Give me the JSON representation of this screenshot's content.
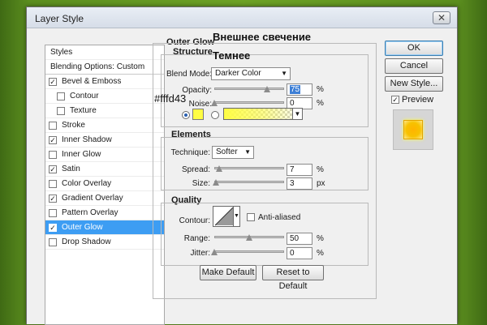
{
  "window": {
    "title": "Layer Style",
    "close_glyph": "✕"
  },
  "annotations": {
    "top": "Внешнее свечение",
    "sub": "Темнее",
    "hex": "#fffd43"
  },
  "sidebar": {
    "header": "Styles",
    "blending": "Blending Options: Custom",
    "items": [
      {
        "label": "Bevel & Emboss",
        "checked": true,
        "indent": false
      },
      {
        "label": "Contour",
        "checked": false,
        "indent": true
      },
      {
        "label": "Texture",
        "checked": false,
        "indent": true
      },
      {
        "label": "Stroke",
        "checked": false,
        "indent": false
      },
      {
        "label": "Inner Shadow",
        "checked": true,
        "indent": false
      },
      {
        "label": "Inner Glow",
        "checked": false,
        "indent": false
      },
      {
        "label": "Satin",
        "checked": true,
        "indent": false
      },
      {
        "label": "Color Overlay",
        "checked": false,
        "indent": false
      },
      {
        "label": "Gradient Overlay",
        "checked": true,
        "indent": false
      },
      {
        "label": "Pattern Overlay",
        "checked": false,
        "indent": false
      },
      {
        "label": "Outer Glow",
        "checked": true,
        "indent": false,
        "selected": true
      },
      {
        "label": "Drop Shadow",
        "checked": false,
        "indent": false
      }
    ]
  },
  "panel": {
    "title": "Outer Glow",
    "structure": {
      "label": "Structure",
      "blend_mode_label": "Blend Mode:",
      "blend_mode_value": "Darker Color",
      "opacity_label": "Opacity:",
      "opacity_value": "75",
      "noise_label": "Noise:",
      "noise_value": "0",
      "unit_percent": "%",
      "swatch_color": "#fffd43"
    },
    "elements": {
      "label": "Elements",
      "technique_label": "Technique:",
      "technique_value": "Softer",
      "spread_label": "Spread:",
      "spread_value": "7",
      "size_label": "Size:",
      "size_value": "3",
      "unit_px": "px"
    },
    "quality": {
      "label": "Quality",
      "contour_label": "Contour:",
      "anti_aliased_label": "Anti-aliased",
      "range_label": "Range:",
      "range_value": "50",
      "jitter_label": "Jitter:",
      "jitter_value": "0"
    },
    "make_default": "Make Default",
    "reset_default": "Reset to Default"
  },
  "buttons": {
    "ok": "OK",
    "cancel": "Cancel",
    "new_style": "New Style...",
    "preview": "Preview",
    "preview_checked": true
  }
}
